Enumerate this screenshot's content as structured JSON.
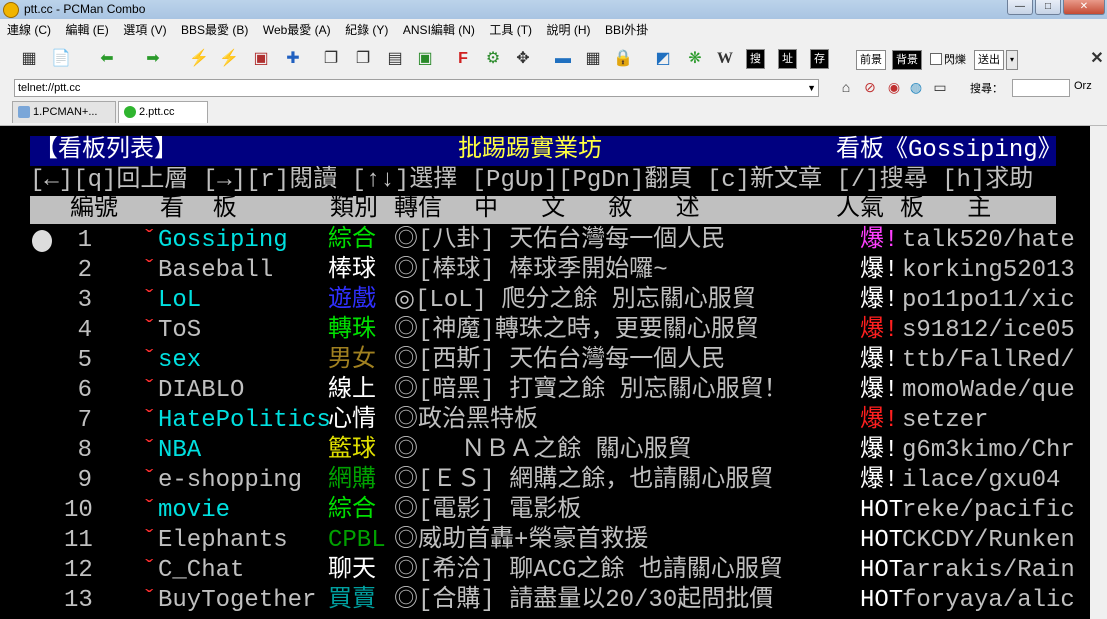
{
  "window": {
    "title": "ptt.cc - PCMan Combo",
    "min": "—",
    "max": "□",
    "close": "✕"
  },
  "menu": [
    "連線 (C)",
    "編輯 (E)",
    "選項 (V)",
    "BBS最愛 (B)",
    "Web最愛 (A)",
    "紀錄 (Y)",
    "ANSI編輯 (N)",
    "工具 (T)",
    "說明 (H)",
    "BBI外掛"
  ],
  "toolbar": {
    "fg": "前景",
    "bg": "背景",
    "blink": "閃爍",
    "send": "送出",
    "wiki": "W",
    "search": "搜",
    "addr": "址",
    "save": "存",
    "close": "✕"
  },
  "address": {
    "value": "telnet://ptt.cc",
    "search_label": "搜尋：",
    "engine": "Orz"
  },
  "tabs": [
    {
      "label": "1.PCMAN+..."
    },
    {
      "label": "2.ptt.cc"
    }
  ],
  "terminal": {
    "header_left": "【看板列表】",
    "header_center": "批踢踢實業坊",
    "header_right": "看板《Gossiping》",
    "help": "[←][q]回上層 [→][r]閱讀 [↑↓]選擇 [PgUp][PgDn]翻頁 [c]新文章 [/]搜尋 [h]求助",
    "col_no": "編號",
    "col_board": "看  板",
    "col_cat": "類別",
    "col_trans": "轉信",
    "col_title": "中   文   敘   述",
    "col_pop": "人氣",
    "col_mod": "板   主",
    "mark": "ˇ",
    "boards": [
      {
        "no": "1",
        "name": "Gossiping",
        "cat": "綜合",
        "title": "◎[八卦] 天佑台灣每一個人民",
        "pop": "爆!",
        "mods": "talk520/hate",
        "name_color": "#00e0e0",
        "cat_color": "#00e000",
        "pop_color": "#ff40ff"
      },
      {
        "no": "2",
        "name": "Baseball",
        "cat": "棒球",
        "title": "◎[棒球] 棒球季開始囉~",
        "pop": "爆!",
        "mods": "korking52013",
        "name_color": "#c0c0c0",
        "cat_color": "#ffffff",
        "pop_color": "#ffffff"
      },
      {
        "no": "3",
        "name": "LoL",
        "cat": "遊戲",
        "title": "◎[LoL] 爬分之餘 別忘關心服貿",
        "pop": "爆!",
        "mods": "po11po11/xic",
        "name_color": "#00e0e0",
        "cat_color": "#3030ff",
        "pop_color": "#ffffff"
      },
      {
        "no": "4",
        "name": "ToS",
        "cat": "轉珠",
        "title": "◎[神魔]轉珠之時，更要關心服貿",
        "pop": "爆!",
        "mods": "s91812/ice05",
        "name_color": "#c0c0c0",
        "cat_color": "#00e000",
        "pop_color": "#ff2020"
      },
      {
        "no": "5",
        "name": "sex",
        "cat": "男女",
        "title": "◎[西斯] 天佑台灣每一個人民",
        "pop": "爆!",
        "mods": "ttb/FallRed/",
        "name_color": "#00e0e0",
        "cat_color": "#a08020",
        "pop_color": "#ffffff"
      },
      {
        "no": "6",
        "name": "DIABLO",
        "cat": "線上",
        "title": "◎[暗黑] 打寶之餘 別忘關心服貿！",
        "pop": "爆!",
        "mods": "momoWade/que",
        "name_color": "#c0c0c0",
        "cat_color": "#ffffff",
        "pop_color": "#ffffff"
      },
      {
        "no": "7",
        "name": "HatePolitics",
        "cat": "心情",
        "title": "◎政治黑特板",
        "pop": "爆!",
        "mods": "setzer",
        "name_color": "#00e0e0",
        "cat_color": "#ffffff",
        "pop_color": "#ff2020"
      },
      {
        "no": "8",
        "name": "NBA",
        "cat": "籃球",
        "title": "◎   ＮＢＡ之餘 關心服貿",
        "pop": "爆!",
        "mods": "g6m3kimo/Chr",
        "name_color": "#00e0e0",
        "cat_color": "#e0e000",
        "pop_color": "#ffffff"
      },
      {
        "no": "9",
        "name": "e-shopping",
        "cat": "網購",
        "title": "◎[ＥＳ] 網購之餘，也請關心服貿",
        "pop": "爆!",
        "mods": "ilace/gxu04",
        "name_color": "#c0c0c0",
        "cat_color": "#00a000",
        "pop_color": "#ffffff"
      },
      {
        "no": "10",
        "name": "movie",
        "cat": "綜合",
        "title": "◎[電影] 電影板",
        "pop": "HOT",
        "mods": "reke/pacific",
        "name_color": "#00e0e0",
        "cat_color": "#00e000",
        "pop_color": "#ffffff"
      },
      {
        "no": "11",
        "name": "Elephants",
        "cat": "CPBL",
        "title": "◎威助首轟+榮豪首救援",
        "pop": "HOT",
        "mods": "CKCDY/Runken",
        "name_color": "#c0c0c0",
        "cat_color": "#00a000",
        "pop_color": "#ffffff"
      },
      {
        "no": "12",
        "name": "C_Chat",
        "cat": "聊天",
        "title": "◎[希洽] 聊ACG之餘 也請關心服貿",
        "pop": "HOT",
        "mods": "arrakis/Rain",
        "name_color": "#c0c0c0",
        "cat_color": "#ffffff",
        "pop_color": "#ffffff"
      },
      {
        "no": "13",
        "name": "BuyTogether",
        "cat": "買賣",
        "title": "◎[合購] 請盡量以20/30起問批價",
        "pop": "HOT",
        "mods": "foryaya/alic",
        "name_color": "#c0c0c0",
        "cat_color": "#00a0a0",
        "pop_color": "#ffffff"
      }
    ]
  }
}
